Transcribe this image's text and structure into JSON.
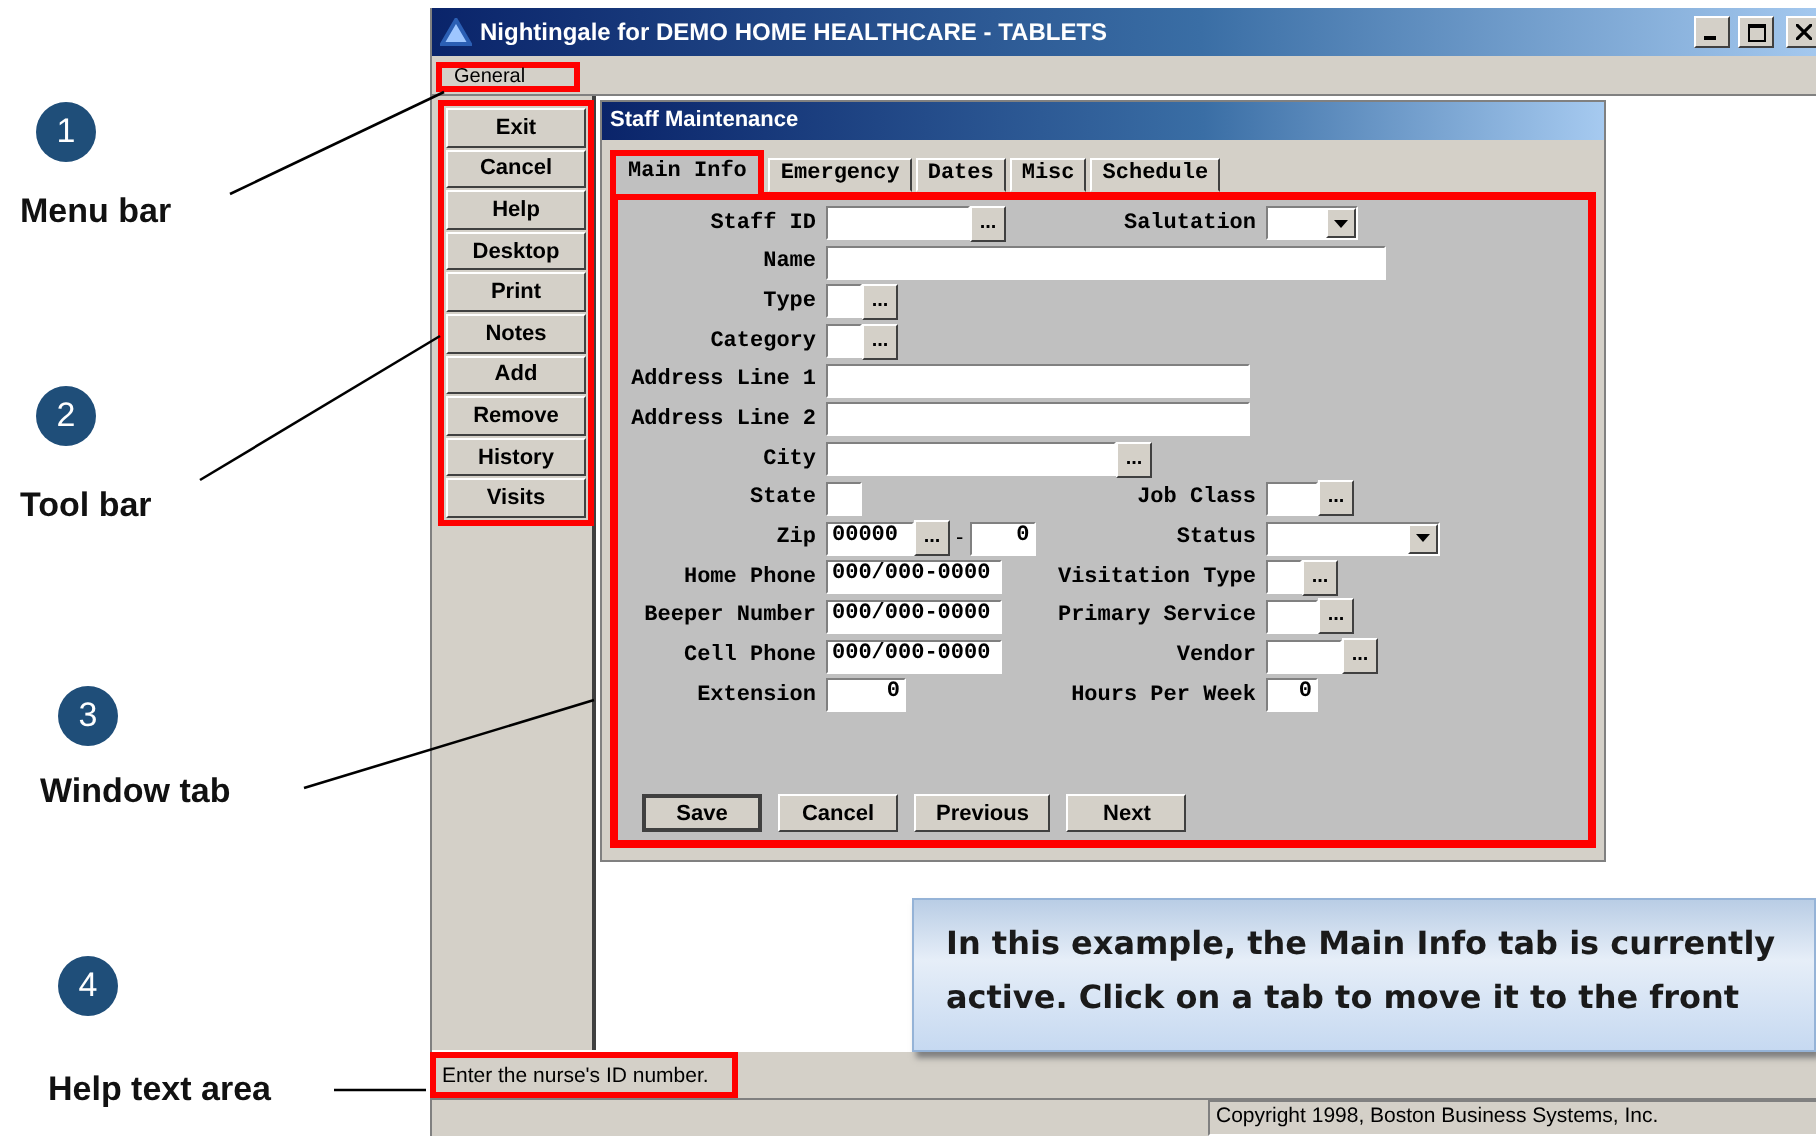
{
  "window": {
    "title": "Nightingale for DEMO HOME HEALTHCARE - TABLETS"
  },
  "menu_bar": [
    {
      "label": "General"
    }
  ],
  "toolbar": [
    {
      "label": "Exit"
    },
    {
      "label": "Cancel"
    },
    {
      "label": "Help"
    },
    {
      "label": "Desktop"
    },
    {
      "label": "Print"
    },
    {
      "label": "Notes"
    },
    {
      "label": "Add"
    },
    {
      "label": "Remove"
    },
    {
      "label": "History"
    },
    {
      "label": "Visits"
    }
  ],
  "child_window": {
    "title": "Staff Maintenance",
    "tabs": [
      {
        "label": "Main Info",
        "selected": true
      },
      {
        "label": "Emergency",
        "selected": false
      },
      {
        "label": "Dates",
        "selected": false
      },
      {
        "label": "Misc",
        "selected": false
      },
      {
        "label": "Schedule",
        "selected": false
      }
    ],
    "form_rows": [
      {
        "left": {
          "label": "Staff ID",
          "kind": "lookup",
          "button": "..."
        },
        "right": {
          "label": "Salutation",
          "kind": "dropdown"
        }
      },
      {
        "left": {
          "label": "Name",
          "kind": "text"
        }
      },
      {
        "left": {
          "label": "Type",
          "kind": "lookup",
          "button": "..."
        }
      },
      {
        "left": {
          "label": "Category",
          "kind": "lookup",
          "button": "..."
        }
      },
      {
        "left": {
          "label": "Address Line 1",
          "kind": "text"
        }
      },
      {
        "left": {
          "label": "Address Line 2",
          "kind": "text"
        }
      },
      {
        "left": {
          "label": "City",
          "kind": "lookup",
          "button": "..."
        }
      },
      {
        "left": {
          "label": "State",
          "kind": "text"
        },
        "right": {
          "label": "Job Class",
          "kind": "lookup",
          "button": "..."
        }
      },
      {
        "left": {
          "label": "Zip",
          "kind": "zip",
          "value": "00000",
          "button": "...",
          "separator": "-",
          "extension": "0"
        },
        "right": {
          "label": "Status",
          "kind": "dropdown"
        }
      },
      {
        "left": {
          "label": "Home Phone",
          "kind": "text",
          "value": "000/000-0000"
        },
        "right": {
          "label": "Visitation Type",
          "kind": "lookup",
          "button": "..."
        }
      },
      {
        "left": {
          "label": "Beeper Number",
          "kind": "text",
          "value": "000/000-0000"
        },
        "right": {
          "label": "Primary Service",
          "kind": "lookup",
          "button": "..."
        }
      },
      {
        "left": {
          "label": "Cell Phone",
          "kind": "text",
          "value": "000/000-0000"
        },
        "right": {
          "label": "Vendor",
          "kind": "lookup",
          "button": "..."
        }
      },
      {
        "left": {
          "label": "Extension",
          "kind": "number",
          "value": "0"
        },
        "right": {
          "label": "Hours Per Week",
          "kind": "number",
          "value": "0"
        }
      }
    ],
    "buttons": [
      {
        "label": "Save"
      },
      {
        "label": "Cancel"
      },
      {
        "label": "Previous"
      },
      {
        "label": "Next"
      }
    ]
  },
  "callout": "In this example, the Main Info tab is currently active. Click on a tab to move it to the front",
  "status_bar": {
    "help_text": "Enter the nurse's ID number.",
    "copyright": "Copyright 1998, Boston Business Systems, Inc."
  },
  "annotations": [
    {
      "number": "1",
      "label": "Menu bar"
    },
    {
      "number": "2",
      "label": "Tool bar"
    },
    {
      "number": "3",
      "label": "Window tab"
    },
    {
      "number": "4",
      "label": "Help text area"
    }
  ]
}
